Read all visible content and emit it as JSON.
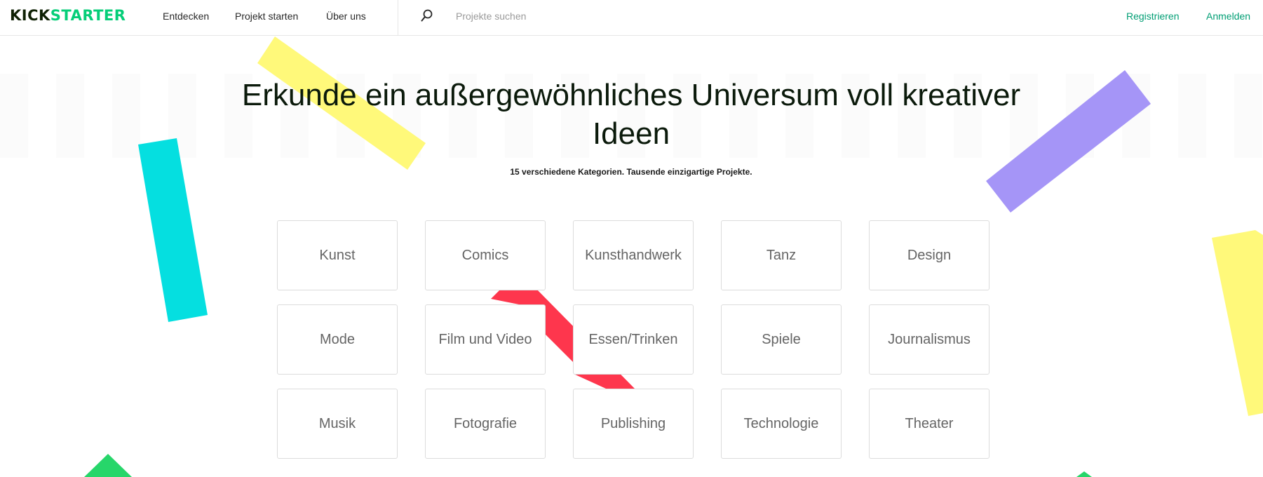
{
  "nav": {
    "logo_kick": "KICK",
    "logo_starter": "STARTER",
    "discover": "Entdecken",
    "start_project": "Projekt starten",
    "about": "Über uns",
    "search_placeholder": "Projekte suchen",
    "register": "Registrieren",
    "login": "Anmelden"
  },
  "hero": {
    "title": "Erkunde ein außergewöhnliches Universum voll kreativer Ideen",
    "subtitle": "15 verschiedene Kategorien. Tausende einzigartige Projekte."
  },
  "categories": [
    "Kunst",
    "Comics",
    "Kunsthandwerk",
    "Tanz",
    "Design",
    "Mode",
    "Film und Video",
    "Essen/Trinken",
    "Spiele",
    "Journalismus",
    "Musik",
    "Fotografie",
    "Publishing",
    "Technologie",
    "Theater"
  ],
  "colors": {
    "brand_dark": "#0f2105",
    "brand_green": "#05ce78",
    "yellow": "#fff97a",
    "cyan": "#05dfe0",
    "purple": "#a595f7",
    "red": "#fe364d",
    "green": "#27d66a"
  },
  "icons": {
    "search": "search-icon"
  }
}
